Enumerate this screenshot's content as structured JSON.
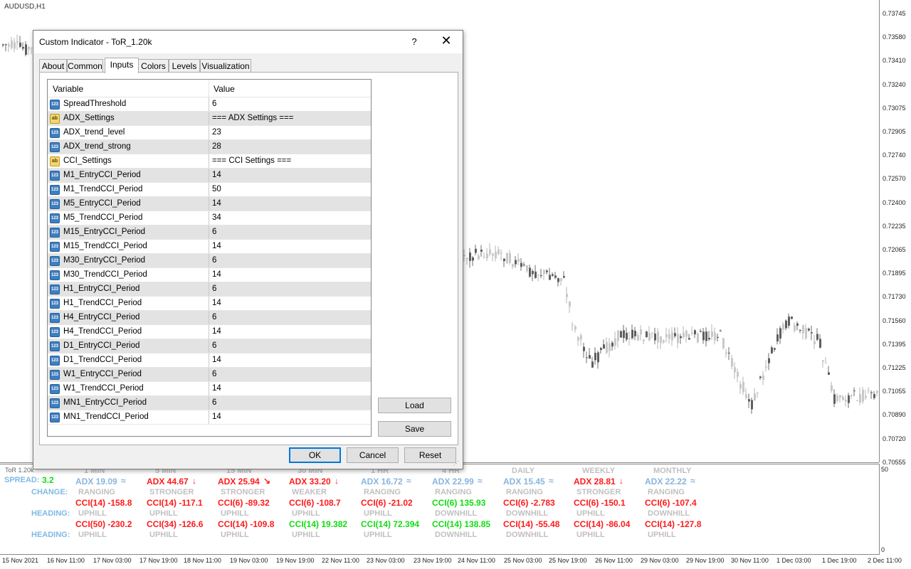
{
  "chart": {
    "symbol": "AUDUSD,H1",
    "price_labels": [
      "0.73745",
      "0.73580",
      "0.73410",
      "0.73240",
      "0.73075",
      "0.72905",
      "0.72740",
      "0.72570",
      "0.72400",
      "0.72235",
      "0.72065",
      "0.71895",
      "0.71730",
      "0.71560",
      "0.71395",
      "0.71225",
      "0.71055",
      "0.70890",
      "0.70720",
      "0.70555"
    ],
    "sub_scale": [
      "50",
      "0"
    ],
    "time_labels": [
      "15 Nov 2021",
      "16 Nov 11:00",
      "17 Nov 03:00",
      "17 Nov 19:00",
      "18 Nov 11:00",
      "19 Nov 03:00",
      "19 Nov 19:00",
      "22 Nov 11:00",
      "23 Nov 03:00",
      "23 Nov 19:00",
      "24 Nov 11:00",
      "25 Nov 03:00",
      "25 Nov 19:00",
      "26 Nov 11:00",
      "29 Nov 03:00",
      "29 Nov 19:00",
      "30 Nov 11:00",
      "1 Dec 03:00",
      "1 Dec 19:00",
      "2 Dec 11:00"
    ]
  },
  "indicator": {
    "tag": "ToR 1.20k",
    "spread_label": "SPREAD:",
    "spread_value": "3.2",
    "change_label": "CHANGE:",
    "heading_label": "HEADING:",
    "columns": [
      {
        "tf": "1 MIN",
        "adx": "ADX 19.09",
        "adx_sym": "≈",
        "adx_color": "blue",
        "state": "RANGING",
        "cci1": "CCI(14) -158.8",
        "cci1_color": "red",
        "head1": "UPHILL",
        "cci2": "CCI(50) -230.2",
        "cci2_color": "red",
        "head2": "UPHILL"
      },
      {
        "tf": "5 MIN",
        "adx": "ADX 44.67",
        "adx_sym": "↓",
        "adx_color": "red",
        "state": "STRONGER",
        "cci1": "CCI(14) -117.1",
        "cci1_color": "red",
        "head1": "UPHILL",
        "cci2": "CCI(34) -126.6",
        "cci2_color": "red",
        "head2": "UPHILL"
      },
      {
        "tf": "15 MIN",
        "adx": "ADX 25.94",
        "adx_sym": "↘",
        "adx_color": "red",
        "state": "STRONGER",
        "cci1": "CCI(6) -89.32",
        "cci1_color": "red",
        "head1": "UPHILL",
        "cci2": "CCI(14) -109.8",
        "cci2_color": "red",
        "head2": "UPHILL"
      },
      {
        "tf": "30 MIN",
        "adx": "ADX 33.20",
        "adx_sym": "↓",
        "adx_color": "red",
        "state": "WEAKER",
        "cci1": "CCI(6) -108.7",
        "cci1_color": "red",
        "head1": "UPHILL",
        "cci2": "CCI(14) 19.382",
        "cci2_color": "green",
        "head2": "UPHILL"
      },
      {
        "tf": "1 HR",
        "adx": "ADX 16.72",
        "adx_sym": "≈",
        "adx_color": "blue",
        "state": "RANGING",
        "cci1": "CCI(6) -21.02",
        "cci1_color": "red",
        "head1": "UPHILL",
        "cci2": "CCI(14) 72.394",
        "cci2_color": "green",
        "head2": "UPHILL"
      },
      {
        "tf": "4 HR",
        "adx": "ADX 22.99",
        "adx_sym": "≈",
        "adx_color": "blue",
        "state": "RANGING",
        "cci1": "CCI(6) 135.93",
        "cci1_color": "green",
        "head1": "DOWNHILL",
        "cci2": "CCI(14) 138.85",
        "cci2_color": "green",
        "head2": "DOWNHILL"
      },
      {
        "tf": "DAILY",
        "adx": "ADX 15.45",
        "adx_sym": "≈",
        "adx_color": "blue",
        "state": "RANGING",
        "cci1": "CCI(6) -2.783",
        "cci1_color": "red",
        "head1": "DOWNHILL",
        "cci2": "CCI(14) -55.48",
        "cci2_color": "red",
        "head2": "DOWNHILL"
      },
      {
        "tf": "WEEKLY",
        "adx": "ADX 28.81",
        "adx_sym": "↓",
        "adx_color": "red",
        "state": "STRONGER",
        "cci1": "CCI(6) -150.1",
        "cci1_color": "red",
        "head1": "UPHILL",
        "cci2": "CCI(14) -86.04",
        "cci2_color": "red",
        "head2": "UPHILL"
      },
      {
        "tf": "MONTHLY",
        "adx": "ADX 22.22",
        "adx_sym": "≈",
        "adx_color": "blue",
        "state": "RANGING",
        "cci1": "CCI(6) -107.4",
        "cci1_color": "red",
        "head1": "DOWNHILL",
        "cci2": "CCI(14) -127.8",
        "cci2_color": "red",
        "head2": "UPHILL"
      }
    ]
  },
  "dialog": {
    "title": "Custom Indicator - ToR_1.20k",
    "help": "?",
    "close": "✕",
    "tabs": [
      "About",
      "Common",
      "Inputs",
      "Colors",
      "Levels",
      "Visualization"
    ],
    "active_tab": "Inputs",
    "headers": {
      "variable": "Variable",
      "value": "Value"
    },
    "rows": [
      {
        "type": "num",
        "name": "SpreadThreshold",
        "value": "6"
      },
      {
        "type": "str",
        "name": "ADX_Settings",
        "value": "=== ADX Settings ==="
      },
      {
        "type": "num",
        "name": "ADX_trend_level",
        "value": "23"
      },
      {
        "type": "num",
        "name": "ADX_trend_strong",
        "value": "28"
      },
      {
        "type": "str",
        "name": "CCI_Settings",
        "value": "=== CCI Settings ==="
      },
      {
        "type": "num",
        "name": "M1_EntryCCI_Period",
        "value": "14"
      },
      {
        "type": "num",
        "name": "M1_TrendCCI_Period",
        "value": "50"
      },
      {
        "type": "num",
        "name": "M5_EntryCCI_Period",
        "value": "14"
      },
      {
        "type": "num",
        "name": "M5_TrendCCI_Period",
        "value": "34"
      },
      {
        "type": "num",
        "name": "M15_EntryCCI_Period",
        "value": "6"
      },
      {
        "type": "num",
        "name": "M15_TrendCCI_Period",
        "value": "14"
      },
      {
        "type": "num",
        "name": "M30_EntryCCI_Period",
        "value": "6"
      },
      {
        "type": "num",
        "name": "M30_TrendCCI_Period",
        "value": "14"
      },
      {
        "type": "num",
        "name": "H1_EntryCCI_Period",
        "value": "6"
      },
      {
        "type": "num",
        "name": "H1_TrendCCI_Period",
        "value": "14"
      },
      {
        "type": "num",
        "name": "H4_EntryCCI_Period",
        "value": "6"
      },
      {
        "type": "num",
        "name": "H4_TrendCCI_Period",
        "value": "14"
      },
      {
        "type": "num",
        "name": "D1_EntryCCI_Period",
        "value": "6"
      },
      {
        "type": "num",
        "name": "D1_TrendCCI_Period",
        "value": "14"
      },
      {
        "type": "num",
        "name": "W1_EntryCCI_Period",
        "value": "6"
      },
      {
        "type": "num",
        "name": "W1_TrendCCI_Period",
        "value": "14"
      },
      {
        "type": "num",
        "name": "MN1_EntryCCI_Period",
        "value": "6"
      },
      {
        "type": "num",
        "name": "MN1_TrendCCI_Period",
        "value": "14"
      }
    ],
    "icon_text": {
      "num": "123",
      "str": "ab"
    },
    "buttons": {
      "load": "Load",
      "save": "Save",
      "ok": "OK",
      "cancel": "Cancel",
      "reset": "Reset"
    }
  }
}
